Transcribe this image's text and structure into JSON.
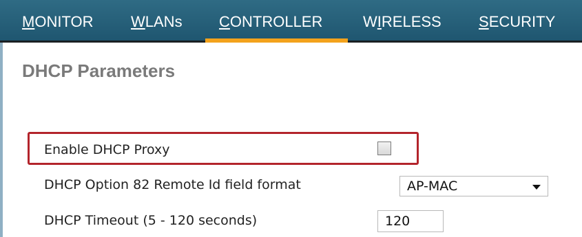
{
  "nav": {
    "items": [
      {
        "label_first": "M",
        "label_rest": "ONITOR",
        "label": "MONITOR"
      },
      {
        "label_first": "W",
        "label_rest": "LANs",
        "label": "WLANs"
      },
      {
        "label_first": "C",
        "label_rest": "ONTROLLER",
        "label": "CONTROLLER"
      },
      {
        "label_first": "W",
        "label_mid": "I",
        "label_rest": "RELESS",
        "label": "WIRELESS"
      },
      {
        "label_first": "S",
        "label_rest": "ECURITY",
        "label": "SECURITY"
      }
    ],
    "active": "CONTROLLER",
    "active_color": "#f3a21c",
    "bar_color": "#2a6580"
  },
  "page": {
    "title": "DHCP Parameters"
  },
  "form": {
    "proxy_label": "Enable DHCP Proxy",
    "proxy_checked": false,
    "option82_label": "DHCP Option 82 Remote Id field format",
    "option82_value": "AP-MAC",
    "timeout_label": "DHCP Timeout (5 - 120 seconds)",
    "timeout_value": "120",
    "highlight_color": "#b3242b"
  }
}
